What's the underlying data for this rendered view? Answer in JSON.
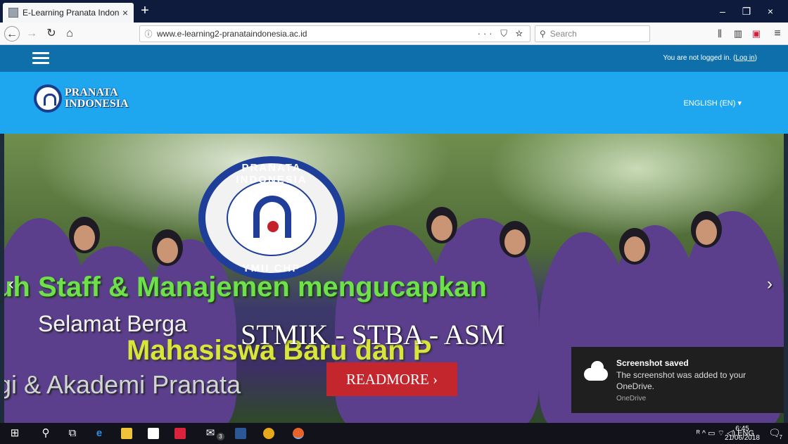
{
  "browser": {
    "tab_title": "E-Learning Pranata Indonesia",
    "tab_close": "×",
    "new_tab": "+",
    "url": "www.e-learning2-pranataindonesia.ac.id",
    "url_actions": "··· ⛉ ☆",
    "search_placeholder": "Search",
    "window_controls": [
      "–",
      "❐",
      "×"
    ]
  },
  "site": {
    "login_text": "You are not logged in. (",
    "login_link": "Log in",
    "login_close": ")",
    "logo_line1": "PRANATA",
    "logo_line2": "INDONESIA",
    "language": "ENGLISH (EN) ▾"
  },
  "slide": {
    "seal_top": "PRANATA INDONESIA",
    "seal_bottom": "YMII CHP",
    "banner_line1": "uh Staff & Manajemen mengucapkan",
    "banner_line2": "Selamat Berga",
    "banner_line3": "Mahasiswa Baru dan P",
    "banner_line4": "gi & Akademi Pranata",
    "title": "STMIK - STBA - ASM",
    "readmore": "READMORE ›",
    "prev": "‹",
    "next": "›"
  },
  "toast": {
    "title": "Screenshot saved",
    "message": "The screenshot was added to your OneDrive.",
    "source": "OneDrive"
  },
  "taskbar": {
    "tray": "ᴿ  ^  ▭  ⌔  ◁)  ENG",
    "time": "6:45",
    "date": "21/06/2018",
    "mail_badge": "3",
    "notif_badge": "7"
  }
}
